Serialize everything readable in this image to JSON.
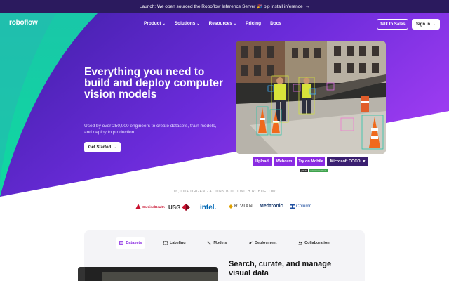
{
  "banner": {
    "text": "Launch: We open sourced the Roboflow Inference Server 🎉 pip install inference",
    "arrow": "→"
  },
  "nav": {
    "logo": "roboflow",
    "menu": [
      {
        "label": "Product",
        "has_dropdown": true
      },
      {
        "label": "Solutions",
        "has_dropdown": true
      },
      {
        "label": "Resources",
        "has_dropdown": true
      },
      {
        "label": "Pricing",
        "has_dropdown": false
      },
      {
        "label": "Docs",
        "has_dropdown": false
      }
    ],
    "talk_to_sales": "Talk to Sales",
    "sign_in": "Sign in",
    "sign_in_arrow": "→"
  },
  "hero": {
    "headline": "Everything you need to build and deploy computer vision models",
    "subtext": "Used by over 250,000 engineers to create datasets, train models, and deploy to production.",
    "cta": "Get Started",
    "cta_arrow": "→"
  },
  "demo": {
    "upload": "Upload",
    "webcam": "Webcam",
    "mobile": "Try on Mobile",
    "model": "Microsoft COCO",
    "model_chevron": "▾",
    "badges": [
      "github",
      "v-inference-latest"
    ]
  },
  "orgs": {
    "label": "16,000+ ORGANIZATIONS BUILD WITH ROBOFLOW",
    "logos": [
      {
        "name": "CardinalHealth",
        "color": "#c8102e"
      },
      {
        "name": "USG",
        "color": "#333333"
      },
      {
        "name": "intel.",
        "color": "#0068b5"
      },
      {
        "name": "RIVIAN",
        "color": "#222222"
      },
      {
        "name": "Medtronic",
        "color": "#1a3b6e"
      },
      {
        "name": "Column",
        "color": "#1f4fa0"
      }
    ]
  },
  "features": {
    "tabs": [
      {
        "label": "Datasets",
        "active": true
      },
      {
        "label": "Labeling",
        "active": false
      },
      {
        "label": "Models",
        "active": false
      },
      {
        "label": "Deployment",
        "active": false
      },
      {
        "label": "Collaboration",
        "active": false
      }
    ],
    "title": "Search, curate, and manage visual data"
  },
  "colors": {
    "accent": "#8a2be2",
    "banner_bg": "#2b1a5e",
    "hero_indigo": "#3b2aa0",
    "hero_teal": "#10d6a3"
  }
}
